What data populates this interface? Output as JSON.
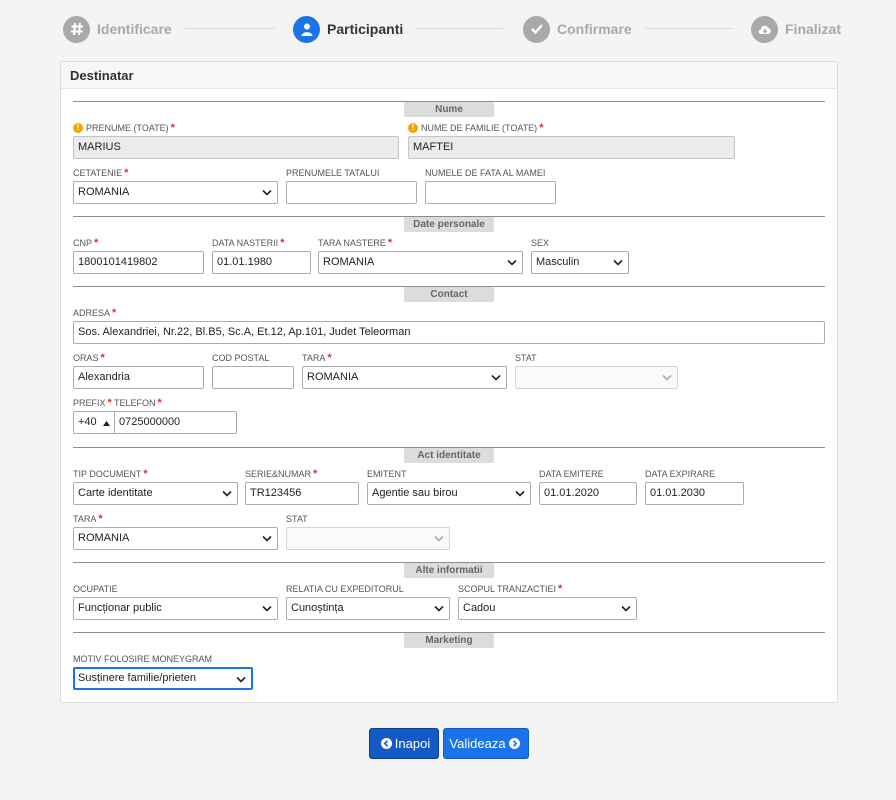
{
  "steps": [
    {
      "label": "Identificare",
      "icon": "hash-icon"
    },
    {
      "label": "Participanti",
      "icon": "user-icon"
    },
    {
      "label": "Confirmare",
      "icon": "check-icon"
    },
    {
      "label": "Finalizat",
      "icon": "cloud-download-icon"
    }
  ],
  "card_title": "Destinatar",
  "sections": {
    "nume": "Nume",
    "date_personale": "Date personale",
    "contact": "Contact",
    "act": "Act identitate",
    "alte": "Alte informatii",
    "marketing": "Marketing"
  },
  "fields": {
    "prenume": {
      "label": "PRENUME (TOATE)",
      "value": "MARIUS"
    },
    "nume_familie": {
      "label": "NUME DE FAMILIE (TOATE)",
      "value": "MAFTEI"
    },
    "cetatenie": {
      "label": "CETATENIE",
      "value": "ROMANIA"
    },
    "prenumele_tatalui": {
      "label": "PRENUMELE TATALUI",
      "value": ""
    },
    "nume_fata_mama": {
      "label": "NUMELE DE FATA AL MAMEI",
      "value": ""
    },
    "cnp": {
      "label": "CNP",
      "value": "1800101419802"
    },
    "data_nasterii": {
      "label": "DATA NASTERII",
      "value": "01.01.1980"
    },
    "tara_nastere": {
      "label": "TARA NASTERE",
      "value": "ROMANIA"
    },
    "sex": {
      "label": "SEX",
      "value": "Masculin"
    },
    "adresa": {
      "label": "ADRESA",
      "value": "Sos. Alexandriei, Nr.22, Bl.B5, Sc.A, Et.12, Ap.101, Judet Teleorman"
    },
    "oras": {
      "label": "ORAS",
      "value": "Alexandria"
    },
    "cod_postal": {
      "label": "COD POSTAL",
      "value": ""
    },
    "tara_contact": {
      "label": "TARA",
      "value": "ROMANIA"
    },
    "stat_contact": {
      "label": "STAT",
      "value": ""
    },
    "prefix": {
      "label": "PREFIX",
      "value": "+40"
    },
    "telefon": {
      "label": "TELEFON",
      "value": "0725000000"
    },
    "tip_document": {
      "label": "TIP DOCUMENT",
      "value": "Carte identitate"
    },
    "serie_numar": {
      "label": "SERIE&NUMAR",
      "value": "TR123456"
    },
    "emitent": {
      "label": "EMITENT",
      "value": "Agentie sau birou"
    },
    "data_emitere": {
      "label": "DATA EMITERE",
      "value": "01.01.2020"
    },
    "data_expirare": {
      "label": "DATA EXPIRARE",
      "value": "01.01.2030"
    },
    "tara_act": {
      "label": "TARA",
      "value": "ROMANIA"
    },
    "stat_act": {
      "label": "STAT",
      "value": ""
    },
    "ocupatie": {
      "label": "OCUPATIE",
      "value": "Funcționar public"
    },
    "relatia": {
      "label": "RELATIA CU EXPEDITORUL",
      "value": "Cunoștința"
    },
    "scopul": {
      "label": "SCOPUL TRANZACTIEI",
      "value": "Cadou"
    },
    "motiv": {
      "label": "MOTIV FOLOSIRE MONEYGRAM",
      "value": "Susținere familie/prieten"
    }
  },
  "buttons": {
    "back": "Inapoi",
    "validate": "Valideaza"
  },
  "colors": {
    "accent": "#1a73e8",
    "required": "#e03131",
    "warning": "#f0a500"
  }
}
